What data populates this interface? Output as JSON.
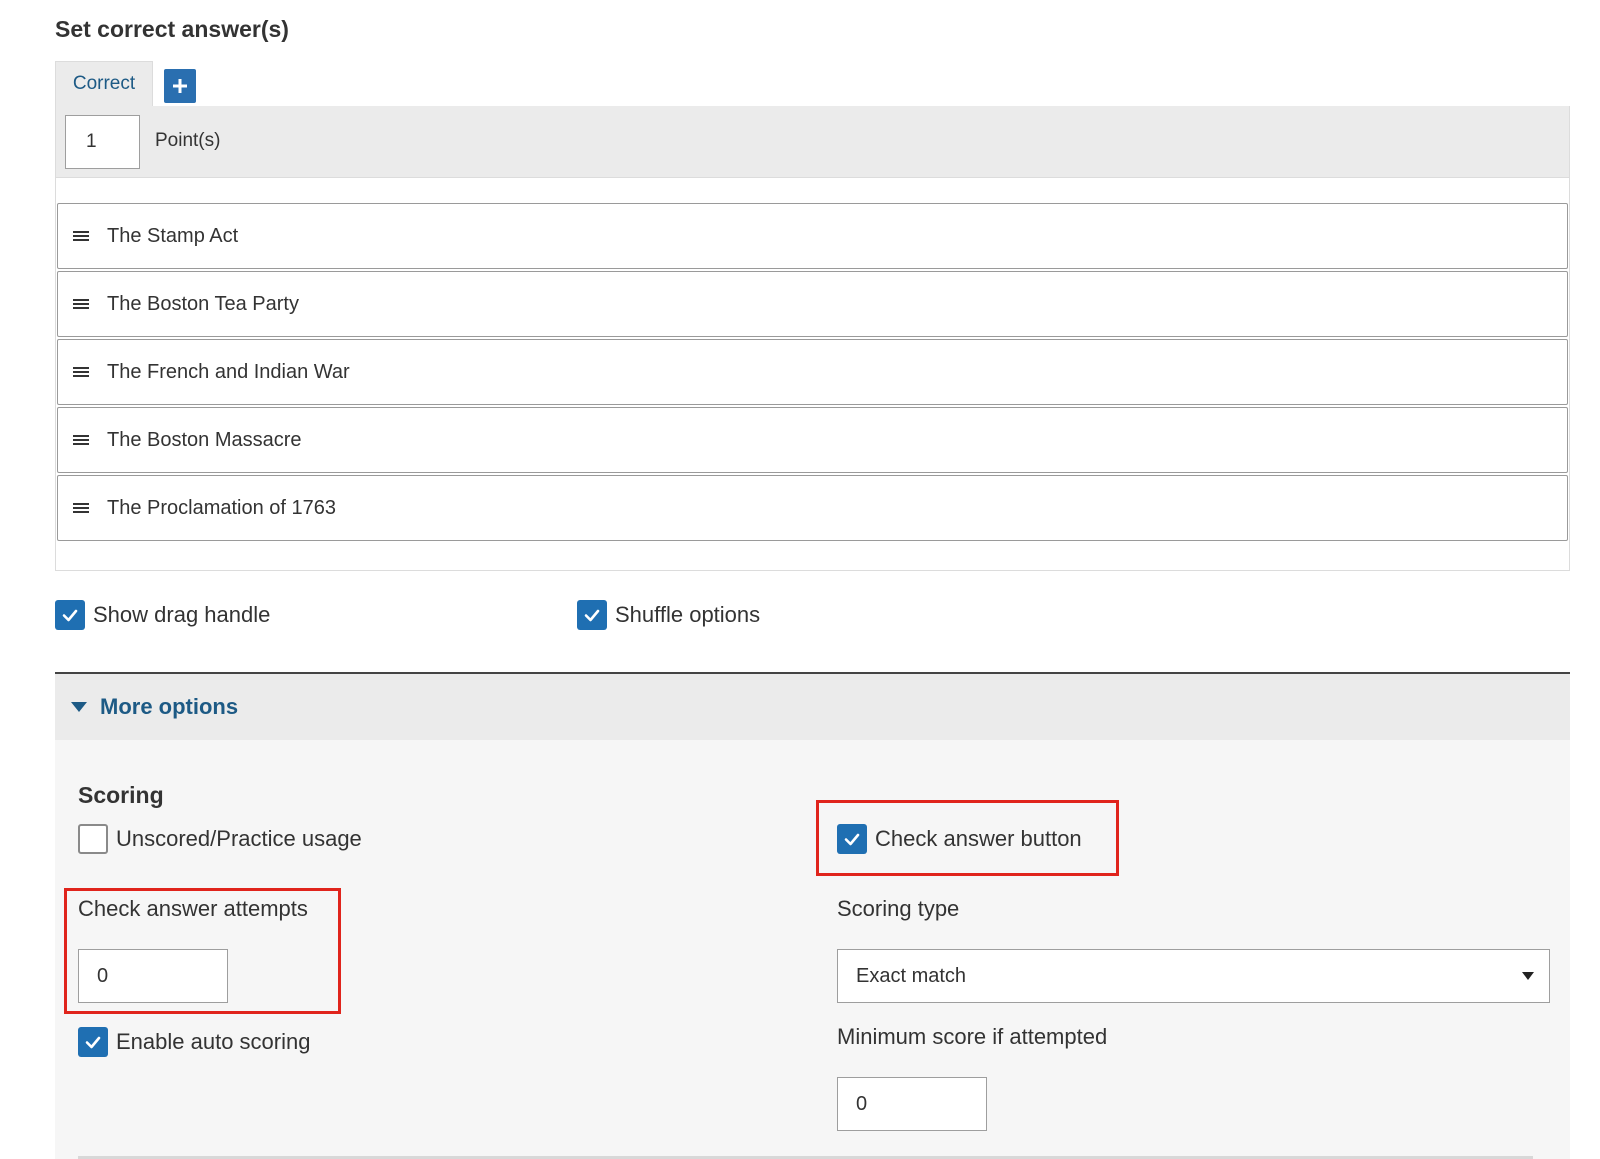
{
  "section": {
    "title": "Set correct answer(s)"
  },
  "tabs": {
    "correct_label": "Correct",
    "add_icon": "plus-icon"
  },
  "points": {
    "value": "1",
    "label": "Point(s)"
  },
  "responses": [
    {
      "label": "The Stamp Act"
    },
    {
      "label": "The Boston Tea Party"
    },
    {
      "label": "The French and Indian War"
    },
    {
      "label": "The Boston Massacre"
    },
    {
      "label": "The Proclamation of 1763"
    }
  ],
  "options": {
    "show_drag_handle": {
      "label": "Show drag handle",
      "checked": true
    },
    "shuffle_options": {
      "label": "Shuffle options",
      "checked": true
    }
  },
  "more_options": {
    "label": "More options",
    "expanded": true
  },
  "scoring": {
    "title": "Scoring",
    "unscored": {
      "label": "Unscored/Practice usage",
      "checked": false
    },
    "check_answer_button": {
      "label": "Check answer button",
      "checked": true
    },
    "check_answer_attempts": {
      "label": "Check answer attempts",
      "value": "0"
    },
    "scoring_type": {
      "label": "Scoring type",
      "value": "Exact match"
    },
    "enable_auto_scoring": {
      "label": "Enable auto scoring",
      "checked": true
    },
    "minimum_score": {
      "label": "Minimum score if attempted",
      "value": "0"
    }
  },
  "colors": {
    "accent": "#1f6fb2",
    "link": "#1d5a85",
    "highlight": "#e0241c",
    "panel": "#ebebeb"
  }
}
